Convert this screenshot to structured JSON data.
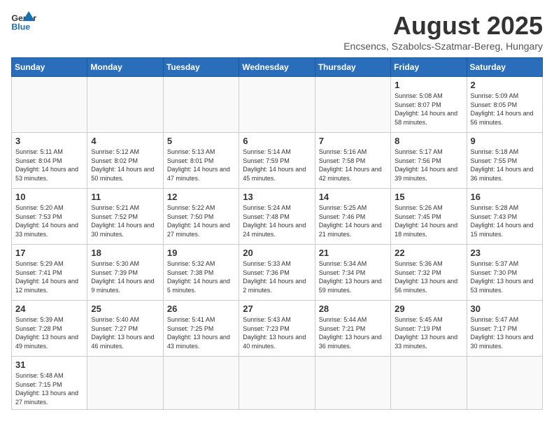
{
  "header": {
    "logo_line1": "General",
    "logo_line2": "Blue",
    "title": "August 2025",
    "subtitle": "Encsencs, Szabolcs-Szatmar-Bereg, Hungary"
  },
  "weekdays": [
    "Sunday",
    "Monday",
    "Tuesday",
    "Wednesday",
    "Thursday",
    "Friday",
    "Saturday"
  ],
  "weeks": [
    [
      {
        "day": "",
        "info": ""
      },
      {
        "day": "",
        "info": ""
      },
      {
        "day": "",
        "info": ""
      },
      {
        "day": "",
        "info": ""
      },
      {
        "day": "",
        "info": ""
      },
      {
        "day": "1",
        "info": "Sunrise: 5:08 AM\nSunset: 8:07 PM\nDaylight: 14 hours and 58 minutes."
      },
      {
        "day": "2",
        "info": "Sunrise: 5:09 AM\nSunset: 8:05 PM\nDaylight: 14 hours and 56 minutes."
      }
    ],
    [
      {
        "day": "3",
        "info": "Sunrise: 5:11 AM\nSunset: 8:04 PM\nDaylight: 14 hours and 53 minutes."
      },
      {
        "day": "4",
        "info": "Sunrise: 5:12 AM\nSunset: 8:02 PM\nDaylight: 14 hours and 50 minutes."
      },
      {
        "day": "5",
        "info": "Sunrise: 5:13 AM\nSunset: 8:01 PM\nDaylight: 14 hours and 47 minutes."
      },
      {
        "day": "6",
        "info": "Sunrise: 5:14 AM\nSunset: 7:59 PM\nDaylight: 14 hours and 45 minutes."
      },
      {
        "day": "7",
        "info": "Sunrise: 5:16 AM\nSunset: 7:58 PM\nDaylight: 14 hours and 42 minutes."
      },
      {
        "day": "8",
        "info": "Sunrise: 5:17 AM\nSunset: 7:56 PM\nDaylight: 14 hours and 39 minutes."
      },
      {
        "day": "9",
        "info": "Sunrise: 5:18 AM\nSunset: 7:55 PM\nDaylight: 14 hours and 36 minutes."
      }
    ],
    [
      {
        "day": "10",
        "info": "Sunrise: 5:20 AM\nSunset: 7:53 PM\nDaylight: 14 hours and 33 minutes."
      },
      {
        "day": "11",
        "info": "Sunrise: 5:21 AM\nSunset: 7:52 PM\nDaylight: 14 hours and 30 minutes."
      },
      {
        "day": "12",
        "info": "Sunrise: 5:22 AM\nSunset: 7:50 PM\nDaylight: 14 hours and 27 minutes."
      },
      {
        "day": "13",
        "info": "Sunrise: 5:24 AM\nSunset: 7:48 PM\nDaylight: 14 hours and 24 minutes."
      },
      {
        "day": "14",
        "info": "Sunrise: 5:25 AM\nSunset: 7:46 PM\nDaylight: 14 hours and 21 minutes."
      },
      {
        "day": "15",
        "info": "Sunrise: 5:26 AM\nSunset: 7:45 PM\nDaylight: 14 hours and 18 minutes."
      },
      {
        "day": "16",
        "info": "Sunrise: 5:28 AM\nSunset: 7:43 PM\nDaylight: 14 hours and 15 minutes."
      }
    ],
    [
      {
        "day": "17",
        "info": "Sunrise: 5:29 AM\nSunset: 7:41 PM\nDaylight: 14 hours and 12 minutes."
      },
      {
        "day": "18",
        "info": "Sunrise: 5:30 AM\nSunset: 7:39 PM\nDaylight: 14 hours and 9 minutes."
      },
      {
        "day": "19",
        "info": "Sunrise: 5:32 AM\nSunset: 7:38 PM\nDaylight: 14 hours and 5 minutes."
      },
      {
        "day": "20",
        "info": "Sunrise: 5:33 AM\nSunset: 7:36 PM\nDaylight: 14 hours and 2 minutes."
      },
      {
        "day": "21",
        "info": "Sunrise: 5:34 AM\nSunset: 7:34 PM\nDaylight: 13 hours and 59 minutes."
      },
      {
        "day": "22",
        "info": "Sunrise: 5:36 AM\nSunset: 7:32 PM\nDaylight: 13 hours and 56 minutes."
      },
      {
        "day": "23",
        "info": "Sunrise: 5:37 AM\nSunset: 7:30 PM\nDaylight: 13 hours and 53 minutes."
      }
    ],
    [
      {
        "day": "24",
        "info": "Sunrise: 5:39 AM\nSunset: 7:28 PM\nDaylight: 13 hours and 49 minutes."
      },
      {
        "day": "25",
        "info": "Sunrise: 5:40 AM\nSunset: 7:27 PM\nDaylight: 13 hours and 46 minutes."
      },
      {
        "day": "26",
        "info": "Sunrise: 5:41 AM\nSunset: 7:25 PM\nDaylight: 13 hours and 43 minutes."
      },
      {
        "day": "27",
        "info": "Sunrise: 5:43 AM\nSunset: 7:23 PM\nDaylight: 13 hours and 40 minutes."
      },
      {
        "day": "28",
        "info": "Sunrise: 5:44 AM\nSunset: 7:21 PM\nDaylight: 13 hours and 36 minutes."
      },
      {
        "day": "29",
        "info": "Sunrise: 5:45 AM\nSunset: 7:19 PM\nDaylight: 13 hours and 33 minutes."
      },
      {
        "day": "30",
        "info": "Sunrise: 5:47 AM\nSunset: 7:17 PM\nDaylight: 13 hours and 30 minutes."
      }
    ],
    [
      {
        "day": "31",
        "info": "Sunrise: 5:48 AM\nSunset: 7:15 PM\nDaylight: 13 hours and 27 minutes."
      },
      {
        "day": "",
        "info": ""
      },
      {
        "day": "",
        "info": ""
      },
      {
        "day": "",
        "info": ""
      },
      {
        "day": "",
        "info": ""
      },
      {
        "day": "",
        "info": ""
      },
      {
        "day": "",
        "info": ""
      }
    ]
  ]
}
